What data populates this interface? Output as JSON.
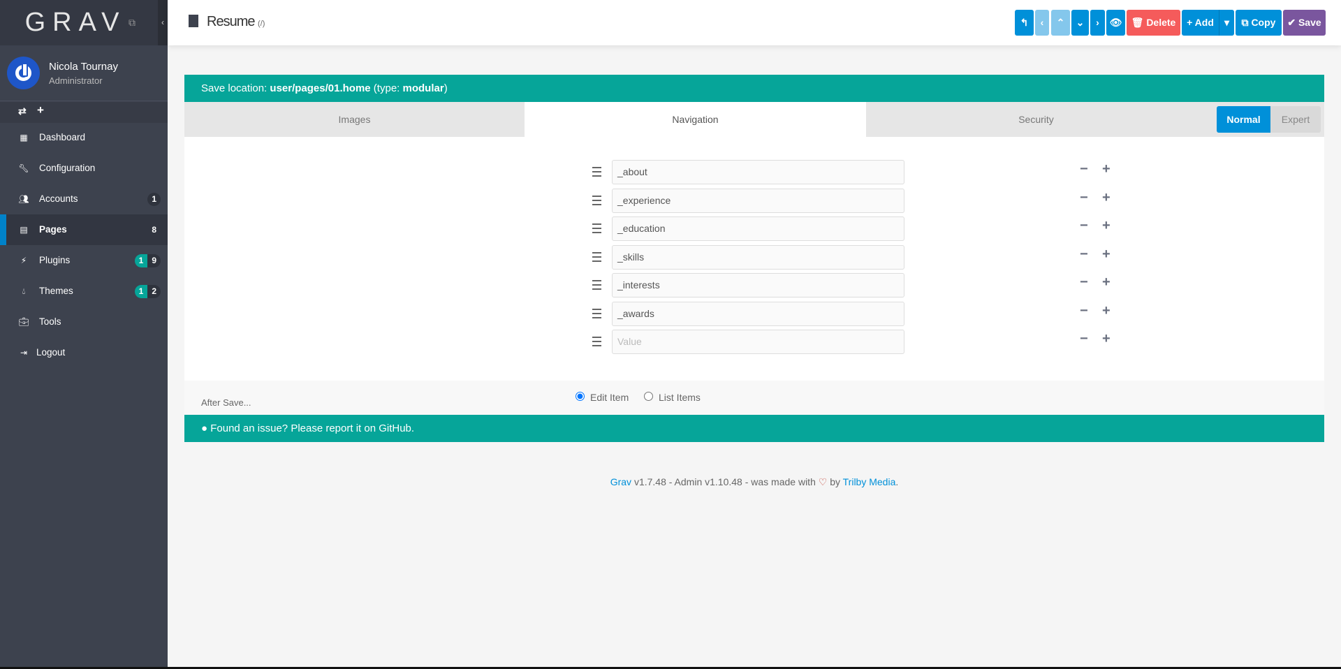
{
  "sidebar": {
    "logo": "GRAV",
    "user": {
      "name": "Nicola Tournay",
      "role": "Administrator"
    },
    "items": [
      {
        "label": "Dashboard",
        "icon": "grid-icon"
      },
      {
        "label": "Configuration",
        "icon": "wrench-icon"
      },
      {
        "label": "Accounts",
        "icon": "users-icon",
        "badge": "1"
      },
      {
        "label": "Pages",
        "icon": "file-icon",
        "badge": "8"
      },
      {
        "label": "Plugins",
        "icon": "plug-icon",
        "badge_updates": "1",
        "badge": "9"
      },
      {
        "label": "Themes",
        "icon": "tint-icon",
        "badge_updates": "1",
        "badge": "2"
      },
      {
        "label": "Tools",
        "icon": "briefcase-icon"
      },
      {
        "label": "Logout",
        "icon": "sign-out-icon"
      }
    ]
  },
  "header": {
    "title": "Resume",
    "route": "(/)",
    "delete": "Delete",
    "add": "Add",
    "copy": "Copy",
    "save": "Save"
  },
  "save_location": {
    "prefix": "Save location: ",
    "path": "user/pages/01.home",
    "type_prefix": " (type: ",
    "type": "modular",
    "type_suffix": ")"
  },
  "tabs": [
    {
      "label": "Images"
    },
    {
      "label": "Navigation",
      "active": true
    },
    {
      "label": "Security"
    }
  ],
  "mode": {
    "normal": "Normal",
    "expert": "Expert",
    "selected": "Normal"
  },
  "list": {
    "values": [
      "_about",
      "_experience",
      "_education",
      "_skills",
      "_interests",
      "_awards"
    ],
    "placeholder": "Value"
  },
  "after_save": {
    "label": "After Save...",
    "options": [
      "Edit Item",
      "List Items"
    ],
    "selected": "Edit Item"
  },
  "issue": "Found an issue? Please report it on GitHub.",
  "credits": {
    "grav": "Grav",
    "mid": " v1.7.48 - Admin v1.10.48 - was made with ",
    "by": " by ",
    "trilby": "Trilby Media",
    "end": "."
  },
  "colors": {
    "teal": "#06a599",
    "blue": "#0090d9",
    "red": "#f55b5b",
    "purple": "#7a569e"
  }
}
